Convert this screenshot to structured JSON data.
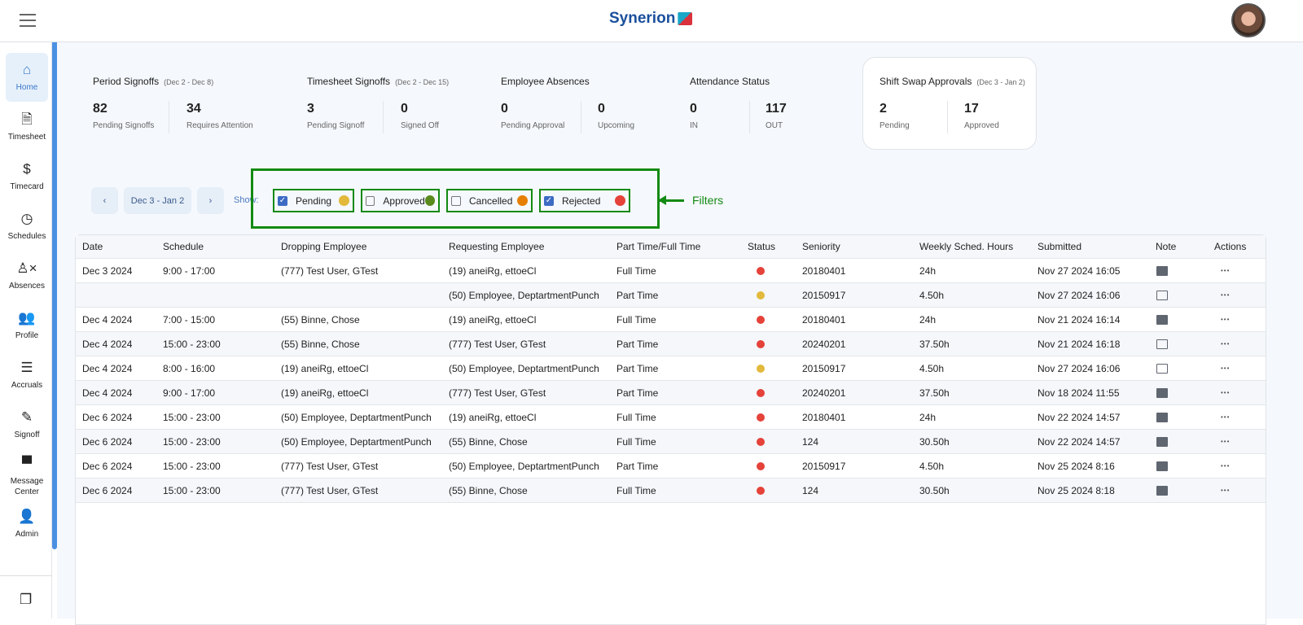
{
  "header": {
    "brand": "Synerion"
  },
  "sidebar": {
    "items": [
      {
        "label": "Home",
        "icon": "home-icon",
        "glyph": "⌂"
      },
      {
        "label": "Timesheet",
        "icon": "document-icon",
        "glyph": "🗎"
      },
      {
        "label": "Timecard",
        "icon": "dollar-icon",
        "glyph": "$"
      },
      {
        "label": "Schedules",
        "icon": "clock-icon",
        "glyph": "◷"
      },
      {
        "label": "Absences",
        "icon": "person-x-icon",
        "glyph": "♙×"
      },
      {
        "label": "Profile",
        "icon": "people-icon",
        "glyph": "👥"
      },
      {
        "label": "Accruals",
        "icon": "list-bank-icon",
        "glyph": "☰"
      },
      {
        "label": "Signoff",
        "icon": "signature-icon",
        "glyph": "✎"
      },
      {
        "label": "Message Center",
        "icon": "chat-icon",
        "glyph": "▀"
      },
      {
        "label": "Admin",
        "icon": "person-icon",
        "glyph": "👤"
      }
    ]
  },
  "stats": [
    {
      "title": "Period Signoffs",
      "range": "(Dec 2 - Dec 8)",
      "values": [
        {
          "n": "82",
          "l": "Pending Signoffs"
        },
        {
          "n": "34",
          "l": "Requires Attention"
        }
      ]
    },
    {
      "title": "Timesheet Signoffs",
      "range": "(Dec 2 - Dec 15)",
      "values": [
        {
          "n": "3",
          "l": "Pending Signoff"
        },
        {
          "n": "0",
          "l": "Signed Off"
        }
      ]
    },
    {
      "title": "Employee Absences",
      "range": "",
      "values": [
        {
          "n": "0",
          "l": "Pending Approval"
        },
        {
          "n": "0",
          "l": "Upcoming"
        }
      ]
    },
    {
      "title": "Attendance Status",
      "range": "",
      "values": [
        {
          "n": "0",
          "l": "IN"
        },
        {
          "n": "117",
          "l": "OUT"
        }
      ]
    },
    {
      "title": "Shift Swap Approvals",
      "range": "(Dec 3 - Jan 2)",
      "values": [
        {
          "n": "2",
          "l": "Pending"
        },
        {
          "n": "17",
          "l": "Approved"
        }
      ]
    }
  ],
  "filters": {
    "date_range": "Dec 3 - Jan 2",
    "show_label": "Show:",
    "annotation": "Filters",
    "items": [
      {
        "label": "Pending",
        "checked": true,
        "color": "#e2b93b"
      },
      {
        "label": "Approved",
        "checked": false,
        "color": "#5a8a1e"
      },
      {
        "label": "Cancelled",
        "checked": false,
        "color": "#e67e00"
      },
      {
        "label": "Rejected",
        "checked": true,
        "color": "#e5423a"
      }
    ]
  },
  "table": {
    "columns": [
      "Date",
      "Schedule",
      "Dropping Employee",
      "Requesting Employee",
      "Part Time/Full Time",
      "Status",
      "Seniority",
      "Weekly Sched. Hours",
      "Submitted",
      "Note",
      "Actions"
    ],
    "rows": [
      {
        "date": "Dec 3 2024",
        "schedule": "9:00 - 17:00",
        "dropping": "(777) Test User, GTest",
        "requesting": "(19) aneiRg, ettoeCl",
        "type": "Full Time",
        "status": "Rejected",
        "seniority": "20180401",
        "hours": "24h",
        "submitted": "Nov 27 2024 16:05",
        "note": true
      },
      {
        "date": "",
        "schedule": "",
        "dropping": "",
        "requesting": "(50) Employee, DeptartmentPunch",
        "type": "Part Time",
        "status": "Pending",
        "seniority": "20150917",
        "hours": "4.50h",
        "submitted": "Nov 27 2024 16:06",
        "note": false
      },
      {
        "date": "Dec 4 2024",
        "schedule": "7:00 - 15:00",
        "dropping": "(55) Binne, Chose",
        "requesting": "(19) aneiRg, ettoeCl",
        "type": "Full Time",
        "status": "Rejected",
        "seniority": "20180401",
        "hours": "24h",
        "submitted": "Nov 21 2024 16:14",
        "note": true
      },
      {
        "date": "Dec 4 2024",
        "schedule": "15:00 - 23:00",
        "dropping": "(55) Binne, Chose",
        "requesting": "(777) Test User, GTest",
        "type": "Part Time",
        "status": "Rejected",
        "seniority": "20240201",
        "hours": "37.50h",
        "submitted": "Nov 21 2024 16:18",
        "note": false
      },
      {
        "date": "Dec 4 2024",
        "schedule": "8:00 - 16:00",
        "dropping": "(19) aneiRg, ettoeCl",
        "requesting": "(50) Employee, DeptartmentPunch",
        "type": "Part Time",
        "status": "Pending",
        "seniority": "20150917",
        "hours": "4.50h",
        "submitted": "Nov 27 2024 16:06",
        "note": false
      },
      {
        "date": "Dec 4 2024",
        "schedule": "9:00 - 17:00",
        "dropping": "(19) aneiRg, ettoeCl",
        "requesting": "(777) Test User, GTest",
        "type": "Part Time",
        "status": "Rejected",
        "seniority": "20240201",
        "hours": "37.50h",
        "submitted": "Nov 18 2024 11:55",
        "note": true
      },
      {
        "date": "Dec 6 2024",
        "schedule": "15:00 - 23:00",
        "dropping": "(50) Employee, DeptartmentPunch",
        "requesting": "(19) aneiRg, ettoeCl",
        "type": "Full Time",
        "status": "Rejected",
        "seniority": "20180401",
        "hours": "24h",
        "submitted": "Nov 22 2024 14:57",
        "note": true
      },
      {
        "date": "Dec 6 2024",
        "schedule": "15:00 - 23:00",
        "dropping": "(50) Employee, DeptartmentPunch",
        "requesting": "(55) Binne, Chose",
        "type": "Full Time",
        "status": "Rejected",
        "seniority": "124",
        "hours": "30.50h",
        "submitted": "Nov 22 2024 14:57",
        "note": true
      },
      {
        "date": "Dec 6 2024",
        "schedule": "15:00 - 23:00",
        "dropping": "(777) Test User, GTest",
        "requesting": "(50) Employee, DeptartmentPunch",
        "type": "Part Time",
        "status": "Rejected",
        "seniority": "20150917",
        "hours": "4.50h",
        "submitted": "Nov 25 2024 8:16",
        "note": true
      },
      {
        "date": "Dec 6 2024",
        "schedule": "15:00 - 23:00",
        "dropping": "(777) Test User, GTest",
        "requesting": "(55) Binne, Chose",
        "type": "Full Time",
        "status": "Rejected",
        "seniority": "124",
        "hours": "30.50h",
        "submitted": "Nov 25 2024 8:18",
        "note": true
      }
    ]
  },
  "status_colors": {
    "Pending": "#e2b93b",
    "Rejected": "#e5423a"
  }
}
